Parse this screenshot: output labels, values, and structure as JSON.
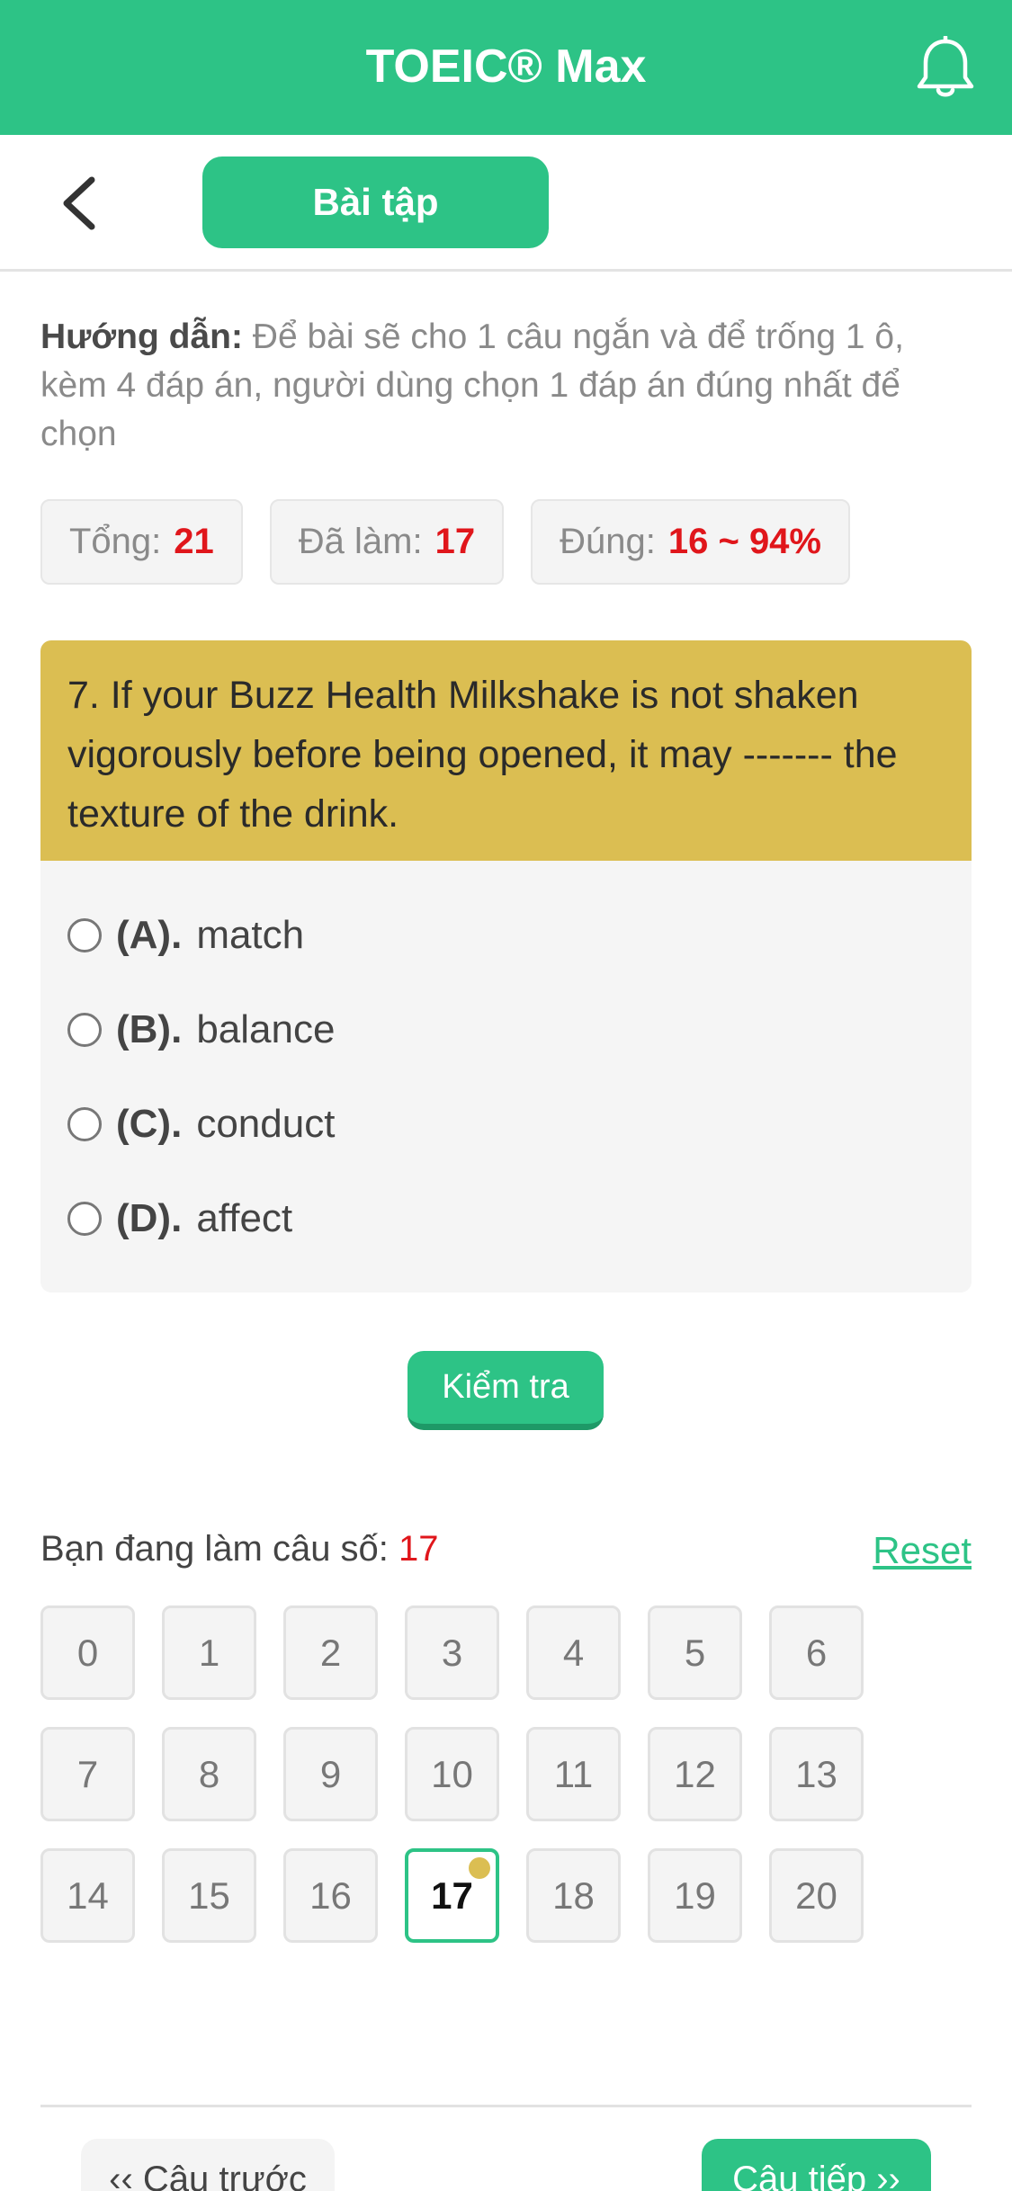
{
  "header": {
    "title": "TOEIC® Max",
    "icon": "bell-icon"
  },
  "subbar": {
    "back_icon": "chevron-left-icon",
    "tab_label": "Bài tập"
  },
  "guide": {
    "label": "Hướng dẫn:",
    "text": "Để bài sẽ cho 1 câu ngắn và để trống 1 ô, kèm 4 đáp án, người dùng chọn 1 đáp án đúng nhất để chọn"
  },
  "stats": {
    "total_label": "Tổng:",
    "total_value": "21",
    "done_label": "Đã làm:",
    "done_value": "17",
    "correct_label": "Đúng:",
    "correct_value": "16 ~ 94%"
  },
  "question": {
    "text": "7. If your Buzz Health Milkshake is not shaken vigorously before being opened, it may ------- the texture of the drink.",
    "options": [
      {
        "letter": "(A).",
        "text": "match"
      },
      {
        "letter": "(B).",
        "text": "balance"
      },
      {
        "letter": "(C).",
        "text": "conduct"
      },
      {
        "letter": "(D).",
        "text": "affect"
      }
    ]
  },
  "check_label": "Kiểm tra",
  "progress": {
    "label": "Bạn đang làm câu số:",
    "value": "17",
    "reset_label": "Reset"
  },
  "grid": {
    "cells": [
      "0",
      "1",
      "2",
      "3",
      "4",
      "5",
      "6",
      "7",
      "8",
      "9",
      "10",
      "11",
      "12",
      "13",
      "14",
      "15",
      "16",
      "17",
      "18",
      "19",
      "20"
    ],
    "active_index": 17
  },
  "nav": {
    "prev_label": "‹‹ Câu trước",
    "next_label": "Câu tiếp ››"
  },
  "colors": {
    "primary": "#2dc386",
    "question_bg": "#dbbe52",
    "highlight": "#e0161b"
  }
}
